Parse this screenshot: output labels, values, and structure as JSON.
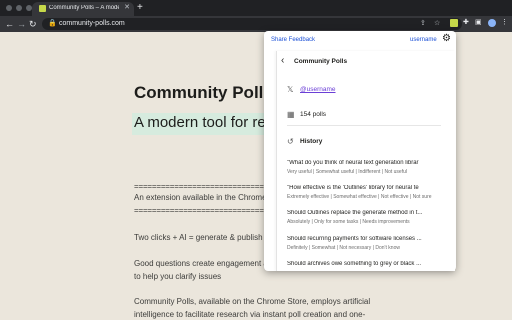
{
  "browser": {
    "tab_title": "Community Polls – A modern to",
    "tab_close": "✕",
    "new_tab": "+",
    "url": "community-polls.com",
    "back_glyph": "←",
    "forward_glyph": "→",
    "reload_glyph": "↻",
    "lock_glyph": "🔒",
    "share_glyph": "⇪",
    "star_glyph": "☆",
    "puzzle_glyph": "✚",
    "sidepanel_glyph": "▣",
    "menu_glyph": "⋮"
  },
  "page": {
    "title": "Community Polls",
    "tagline": "A modern tool for re",
    "rule": "================================================",
    "ext_line": "An extension available in the Chrome",
    "formula": "Two clicks + AI = generate & publish o",
    "engage_line1": "Good questions create engagement a",
    "engage_line2": "to help you clarify issues",
    "desc_line1": "Community Polls, available on the Chrome Store, employs artificial",
    "desc_line2": "intelligence to facilitate research via instant poll creation and one-"
  },
  "popup": {
    "share_feedback": "Share Feedback",
    "username": "username",
    "gear_glyph": "⚙",
    "back_glyph": "‹",
    "title": "Community Polls",
    "x_glyph": "𝕏",
    "handle": "@username",
    "polls_glyph": "▦",
    "polls_count": "154 polls",
    "history_glyph": "↺",
    "history_label": "History",
    "history": [
      {
        "question": "\"What do you think of neural text generation librar",
        "answers": "Very useful | Somewhat useful | Indifferent | Not useful"
      },
      {
        "question": "\"How effective is the 'Outlines' library for neural te",
        "answers": "Extremely effective | Somewhat effective | Not effective | Not sure"
      },
      {
        "question": "Should Outlines replace the generate method in t...",
        "answers": "Absolutely | Only for some tasks | Needs improvements"
      },
      {
        "question": "Should recurring payments for software licenses ...",
        "answers": "Definitely | Somewhat | Not necessary | Don't know"
      },
      {
        "question": "Should archives owe something to grey or black ...",
        "answers": ""
      }
    ]
  },
  "colors": {
    "page_bg": "#ebe6dc",
    "highlight": "#d6ebde",
    "link": "#1a4fd6",
    "handle": "#6b3fd6",
    "extension_accent": "#c6d84a"
  }
}
